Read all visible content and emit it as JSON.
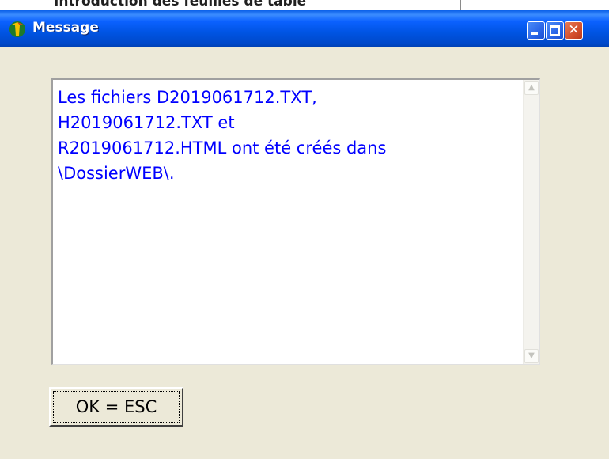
{
  "background_window": {
    "partial_text": "Introduction des feuilles de table"
  },
  "window": {
    "title": "Message",
    "icons": {
      "app": "app-logo-icon",
      "minimize": "minimize-icon",
      "maximize": "maximize-icon",
      "close": "close-icon"
    },
    "close_glyph": "✕"
  },
  "message": {
    "text": "Les fichiers D2019061712.TXT,\nH2019061712.TXT et\nR2019061712.HTML ont été créés dans\n\\DossierWEB\\.",
    "text_color": "#0000ff"
  },
  "scrollbar": {
    "up_glyph": "▲",
    "down_glyph": "▼"
  },
  "buttons": {
    "ok_label": "OK = ESC"
  },
  "colors": {
    "titlebar": "#0054e3",
    "close_button": "#d44f2c",
    "dialog_background": "#ece9d8"
  }
}
